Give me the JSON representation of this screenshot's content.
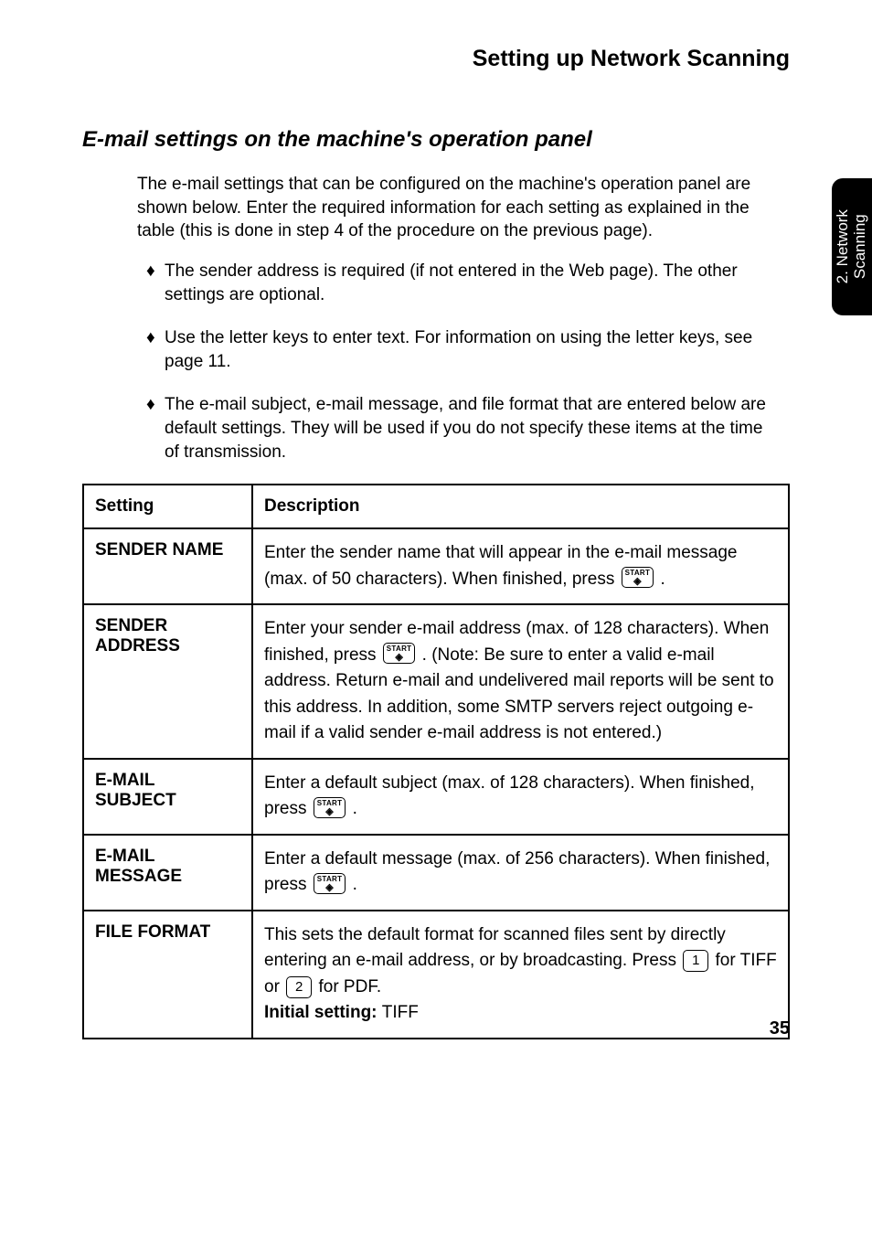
{
  "header": {
    "title": "Setting up Network Scanning"
  },
  "sideTab": {
    "line1": "2. Network",
    "line2": "Scanning"
  },
  "section": {
    "title": "E-mail settings on the machine's operation panel"
  },
  "intro": "The e-mail settings that can be configured on the machine's operation panel are shown below. Enter the required information for each setting as explained in the table (this is done in step 4 of the procedure on the previous page).",
  "bullets": [
    "The sender address is required (if not entered in the Web page). The other settings are optional.",
    "Use the letter keys to enter text. For information on using the letter keys, see page 11.",
    "The e-mail subject, e-mail message, and file format that are entered below are default settings. They will be used if you do not specify these items at the time of transmission."
  ],
  "table": {
    "headers": {
      "setting": "Setting",
      "description": "Description"
    },
    "rows": [
      {
        "setting": "SENDER NAME",
        "desc_a": "Enter the sender name that will appear in the e-mail message (max. of 50 characters). When finished, press ",
        "desc_b": "."
      },
      {
        "setting": "SENDER ADDRESS",
        "desc_a": "Enter your sender e-mail address (max. of 128 characters). When finished, press ",
        "desc_b": ". (Note: Be sure to enter a valid e-mail address. Return e-mail and undelivered mail reports will be sent to this address. In addition, some SMTP servers reject outgoing e-mail if a valid sender e-mail address is not entered.)"
      },
      {
        "setting": "E-MAIL SUBJECT",
        "desc_a": "Enter a default subject (max. of 128 characters). When finished, press ",
        "desc_b": "."
      },
      {
        "setting": "E-MAIL MESSAGE",
        "desc_a": "Enter a default message (max. of 256 characters). When finished, press ",
        "desc_b": "."
      },
      {
        "setting": "FILE FORMAT",
        "desc_a": "This sets the default format for scanned files sent by directly entering an e-mail address, or by broadcasting. Press ",
        "key1": "1",
        "desc_b": " for TIFF or ",
        "key2": "2",
        "desc_c": " for PDF.",
        "initial_label": "Initial setting: ",
        "initial_value": "TIFF"
      }
    ]
  },
  "keys": {
    "start_label": "START",
    "start_symbol": "◈"
  },
  "pageNumber": "35"
}
